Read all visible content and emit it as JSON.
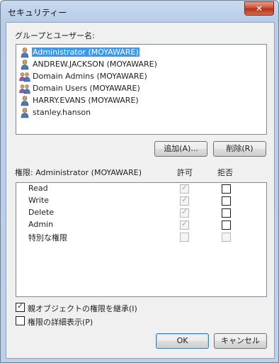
{
  "window": {
    "title": "セキュリティー",
    "close_glyph": "✕"
  },
  "groups_label": "グループとユーザー名:",
  "users": [
    {
      "name": "Administrator (MOYAWARE)",
      "icon": "single-user-icon",
      "selected": true
    },
    {
      "name": "ANDREW.JACKSON (MOYAWARE)",
      "icon": "single-user-icon",
      "selected": false
    },
    {
      "name": "Domain Admins (MOYAWARE)",
      "icon": "group-users-icon",
      "selected": false
    },
    {
      "name": "Domain Users (MOYAWARE)",
      "icon": "group-users-icon",
      "selected": false
    },
    {
      "name": "HARRY.EVANS (MOYAWARE)",
      "icon": "single-user-icon",
      "selected": false
    },
    {
      "name": "stanley.hanson",
      "icon": "single-user-icon",
      "selected": false
    }
  ],
  "buttons": {
    "add": "追加(A)...",
    "remove": "削除(R)",
    "ok": "OK",
    "cancel": "キャンセル"
  },
  "perm_header": {
    "title": "権限: Administrator (MOYAWARE)",
    "allow": "許可",
    "deny": "拒否"
  },
  "permissions": [
    {
      "name": "Read",
      "allow": true,
      "allow_enabled": false,
      "deny": false,
      "deny_enabled": true
    },
    {
      "name": "Write",
      "allow": true,
      "allow_enabled": false,
      "deny": false,
      "deny_enabled": true
    },
    {
      "name": "Delete",
      "allow": true,
      "allow_enabled": false,
      "deny": false,
      "deny_enabled": true
    },
    {
      "name": "Admin",
      "allow": true,
      "allow_enabled": false,
      "deny": false,
      "deny_enabled": true
    },
    {
      "name": "特別な権限",
      "allow": false,
      "allow_enabled": false,
      "deny": false,
      "deny_enabled": false
    }
  ],
  "options": [
    {
      "label": "親オブジェクトの権限を継承(I)",
      "checked": true
    },
    {
      "label": "権限の詳細表示(P)",
      "checked": false
    }
  ],
  "colors": {
    "selection": "#3399ff",
    "titlebar": "#b9cde8"
  }
}
